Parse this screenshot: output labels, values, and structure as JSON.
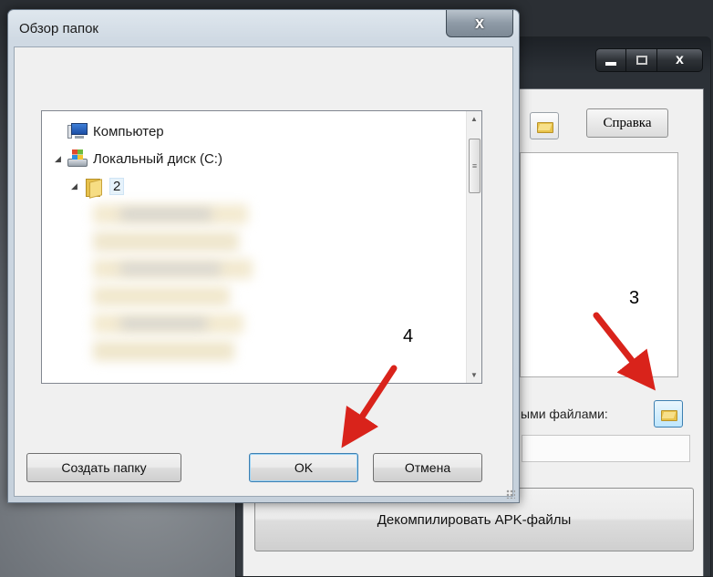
{
  "dialog": {
    "title": "Обзор папок",
    "close_label": "x",
    "tree": {
      "items": [
        {
          "label": "Компьютер",
          "icon": "computer-icon"
        },
        {
          "label": "Локальный диск (C:)",
          "icon": "drive-icon"
        },
        {
          "label": "2",
          "icon": "folder-icon"
        }
      ]
    },
    "buttons": {
      "new_folder": "Создать папку",
      "ok": "OK",
      "cancel": "Отмена"
    }
  },
  "background_window": {
    "caption": {
      "close_label": "x"
    },
    "help_button": "Справка",
    "files_label": "ыми файлами:",
    "decompile_button": "Декомпилировать APK-файлы"
  },
  "annotations": {
    "step3": "3",
    "step4": "4",
    "arrow_color": "#d9231b"
  },
  "colors": {
    "folder": "#e8c34b",
    "selection": "#cce8ff",
    "focus_border": "#3c7fb1"
  }
}
